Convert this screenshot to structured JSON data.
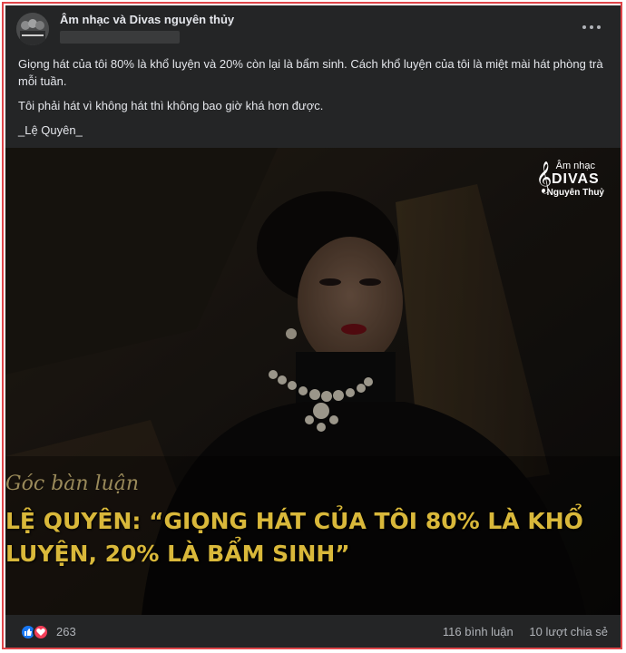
{
  "post": {
    "page_name": "Âm nhạc và Divas nguyên thủy",
    "menu_icon": "more-horizontal-icon",
    "paragraphs": [
      "Giọng hát của tôi 80% là khổ luyện và 20% còn lại là bẩm sinh. Cách khổ luyện của tôi là miệt mài hát phòng trà mỗi tuần.",
      "Tôi phải hát vì không hát thì không bao giờ khá hơn được.",
      "_Lệ Quyên_"
    ]
  },
  "image": {
    "logo": {
      "line1": "Âm nhạc",
      "line2": "DIVAS",
      "line3": "Nguyên Thuỷ"
    },
    "caption_script": "Góc bàn luận",
    "headline_line1": "LỆ QUYÊN: “GIỌNG HÁT CỦA TÔI 80% LÀ KHỔ",
    "headline_line2": "LUYỆN, 20% LÀ BẨM SINH”"
  },
  "footer": {
    "reaction_icons": [
      "like-icon",
      "love-icon"
    ],
    "reaction_count": "263",
    "comments": "116 bình luận",
    "shares": "10 lượt chia sẻ"
  },
  "colors": {
    "card_bg": "#242526",
    "text_primary": "#e4e6eb",
    "text_secondary": "#b0b3b8",
    "headline": "#d9b83a",
    "like_blue": "#1877f2",
    "love_red": "#f33e58",
    "frame_border": "#e0464a"
  }
}
